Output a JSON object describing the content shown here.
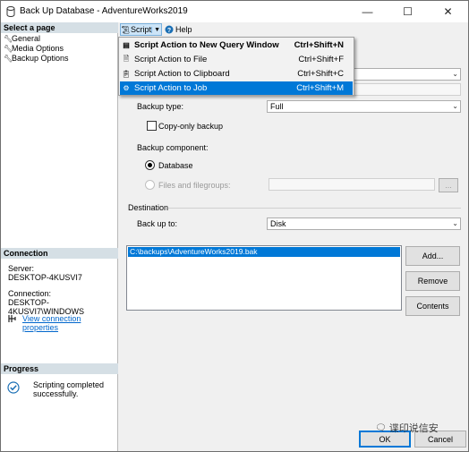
{
  "window": {
    "title": "Back Up Database - AdventureWorks2019",
    "minimize": "—",
    "maximize": "☐",
    "close": "✕"
  },
  "left_pane": {
    "select_page_header": "Select a page",
    "pages": [
      {
        "label": "General"
      },
      {
        "label": "Media Options"
      },
      {
        "label": "Backup Options"
      }
    ],
    "connection_header": "Connection",
    "server_label": "Server:",
    "server_value": "DESKTOP-4KUSVI7",
    "connection_label": "Connection:",
    "connection_value": "DESKTOP-4KUSVI7\\WINDOWS",
    "view_connection_properties": "View connection properties",
    "progress_header": "Progress",
    "progress_status": "Scripting completed successfully."
  },
  "toolbar": {
    "script_label": "Script",
    "help_label": "Help"
  },
  "script_menu": {
    "items": [
      {
        "label": "Script Action to New Query Window",
        "shortcut": "Ctrl+Shift+N",
        "icon": "new-query-icon"
      },
      {
        "label": "Script Action to File",
        "shortcut": "Ctrl+Shift+F",
        "icon": "file-icon"
      },
      {
        "label": "Script Action to Clipboard",
        "shortcut": "Ctrl+Shift+C",
        "icon": "clipboard-icon"
      },
      {
        "label": "Script Action to Job",
        "shortcut": "Ctrl+Shift+M",
        "icon": "job-icon"
      }
    ],
    "selected_index": 3
  },
  "form": {
    "backup_type_label": "Backup type:",
    "backup_type_value": "Full",
    "copy_only_label": "Copy-only backup",
    "copy_only_checked": false,
    "backup_component_label": "Backup component:",
    "database_label": "Database",
    "files_label": "Files and filegroups:",
    "files_browse_button": "...",
    "destination_label": "Destination",
    "back_up_to_label": "Back up to:",
    "back_up_to_value": "Disk",
    "destinations": [
      "C:\\backups\\AdventureWorks2019.bak"
    ],
    "add_button": "Add...",
    "remove_button": "Remove",
    "contents_button": "Contents"
  },
  "footer": {
    "ok_button": "OK",
    "cancel_button": "Cancel"
  },
  "watermark": "谍印说信安",
  "colors": {
    "selection": "#0078d7",
    "header_bg": "#d5dfe5",
    "link": "#0066cc"
  }
}
